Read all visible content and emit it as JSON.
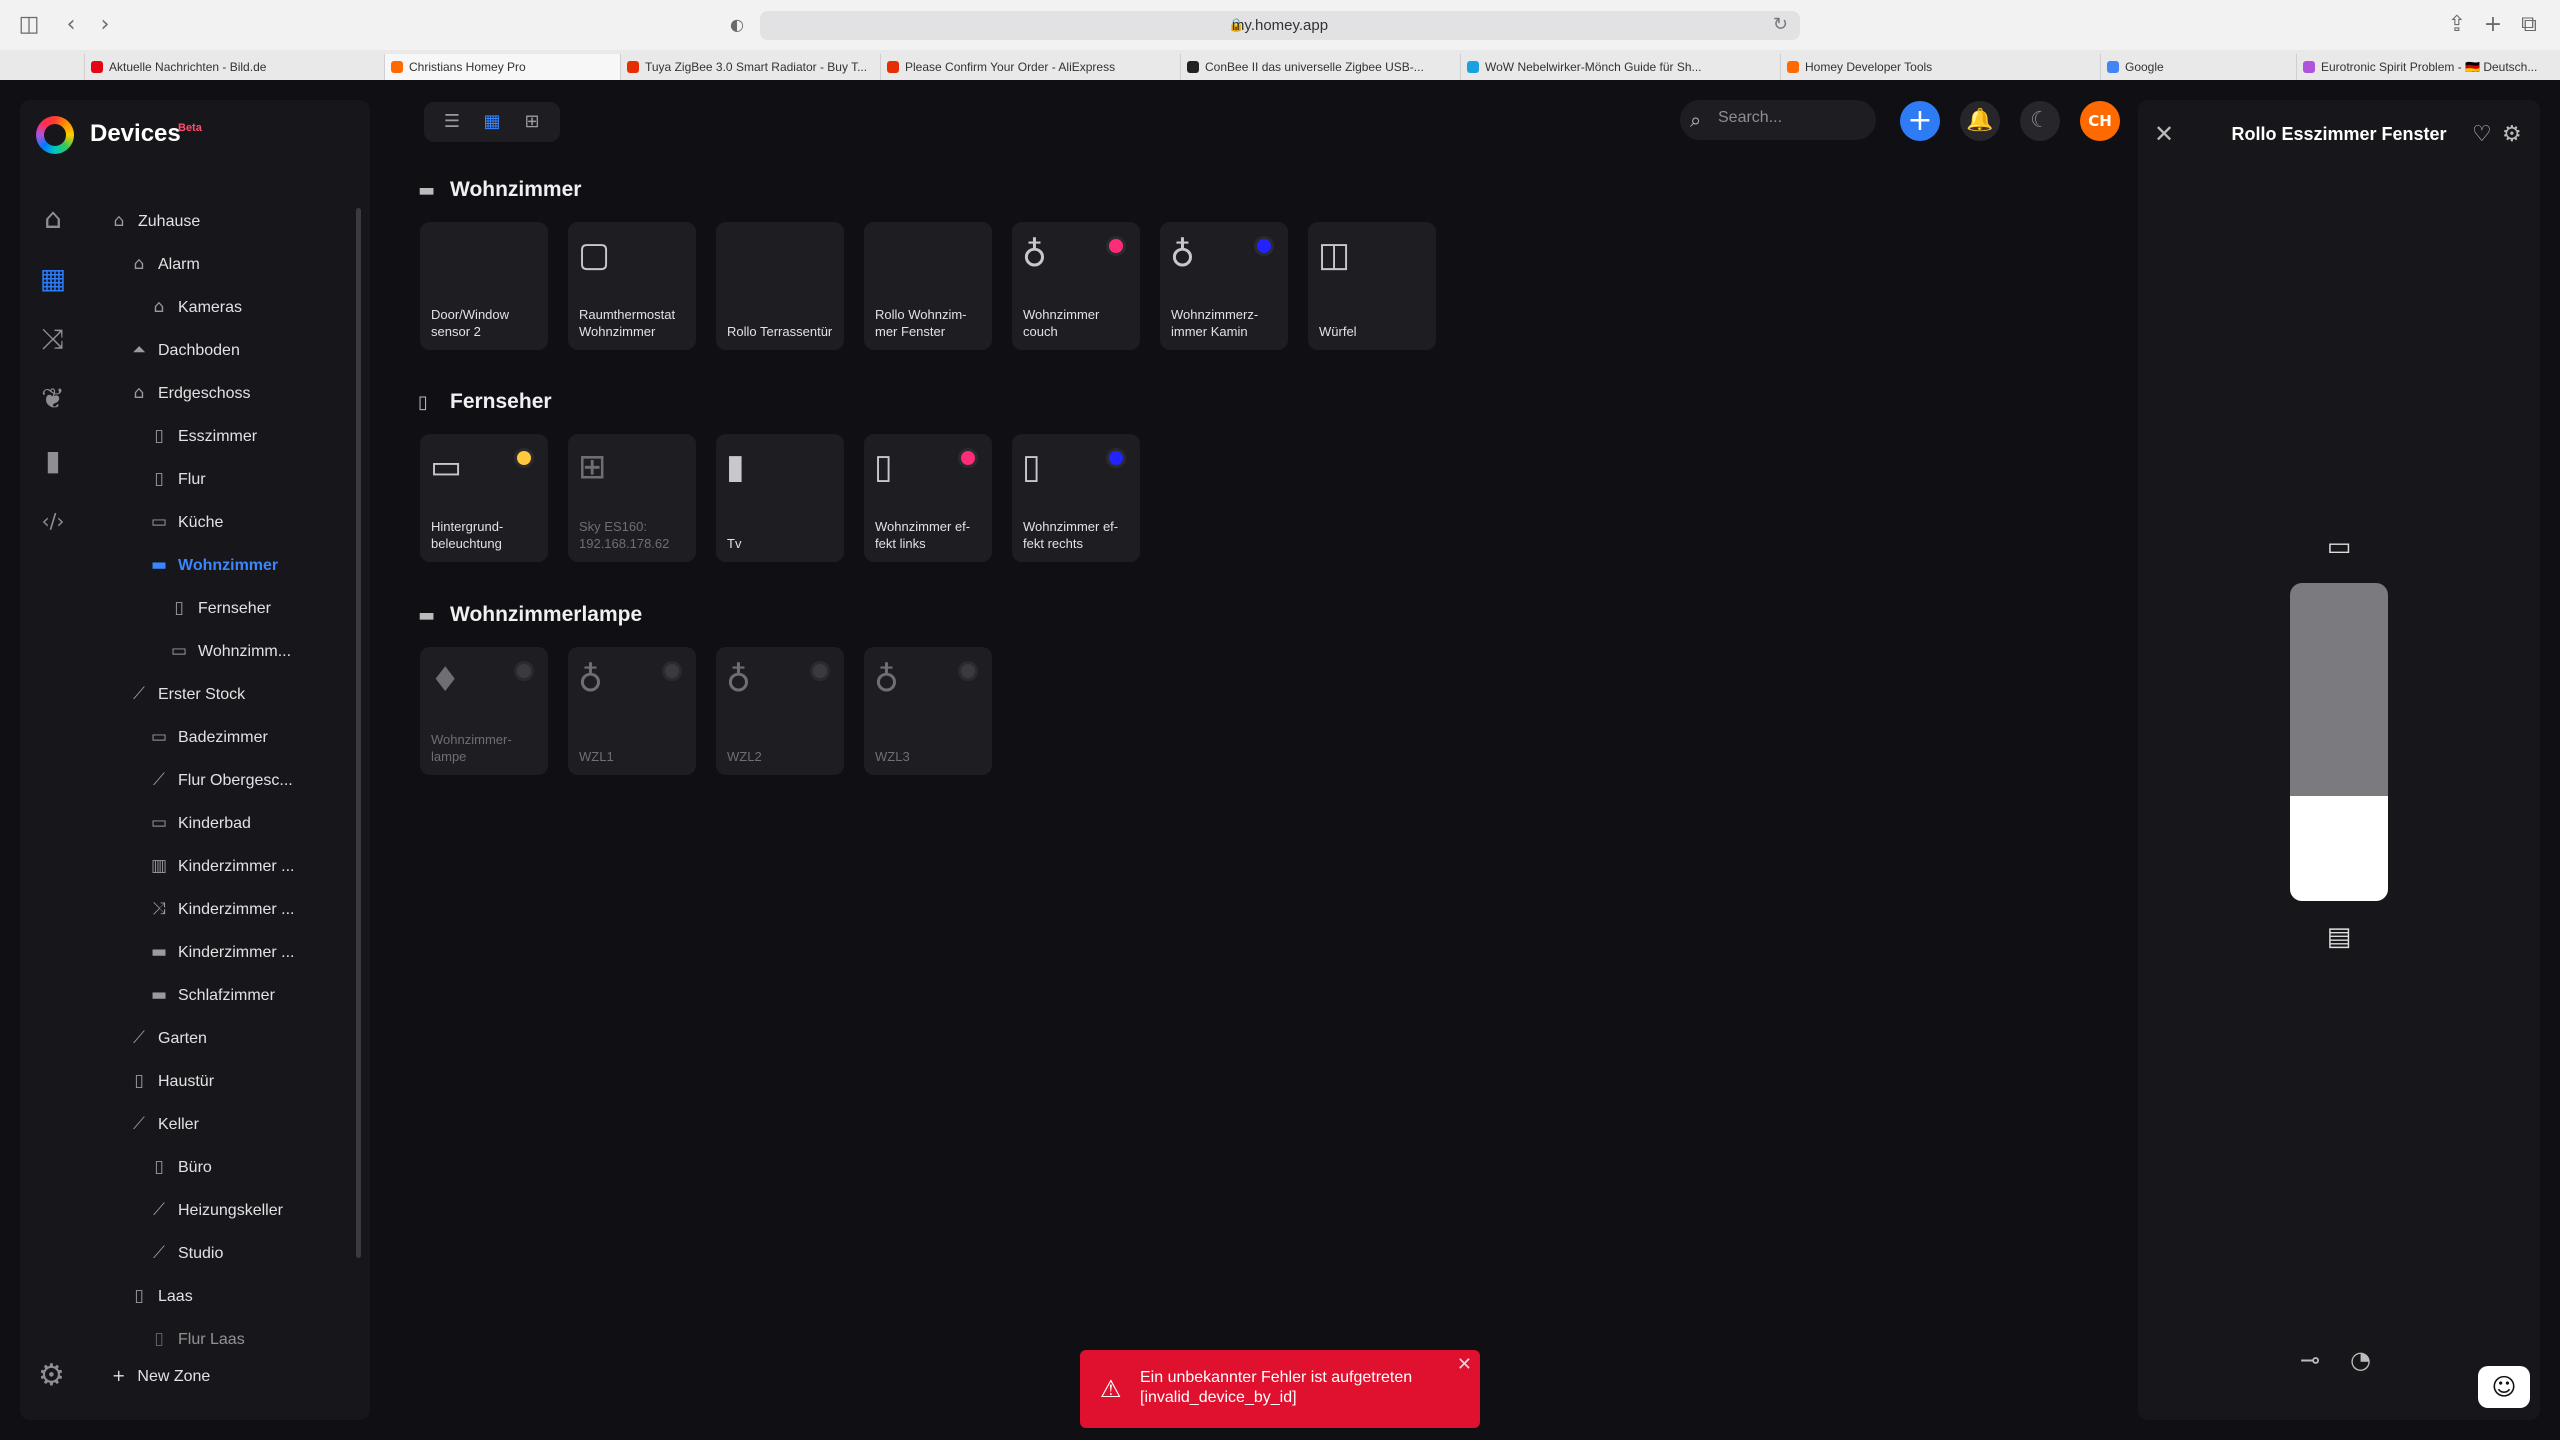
{
  "browser": {
    "url": "my.homey.app",
    "tabs": [
      {
        "label": "Aktuelle Nachrichten - Bild.de",
        "color": "#e30613"
      },
      {
        "label": "Christians Homey Pro",
        "color": "#ff6a00"
      },
      {
        "label": "Tuya ZigBee 3.0 Smart Radiator - Buy T...",
        "color": "#e62e04"
      },
      {
        "label": "Please Confirm Your Order - AliExpress",
        "color": "#e62e04"
      },
      {
        "label": "ConBee II das universelle Zigbee USB-...",
        "color": "#222222"
      },
      {
        "label": "WoW Nebelwirker-Mönch Guide für Sh...",
        "color": "#1ba1e2"
      },
      {
        "label": "Homey Developer Tools",
        "color": "#ff6a00"
      },
      {
        "label": "Google",
        "color": "#4285f4"
      },
      {
        "label": "Eurotronic Spirit Problem - 🇩🇪 Deutsch...",
        "color": "#af52de"
      }
    ]
  },
  "app": {
    "title": "Devices",
    "badge": "Beta"
  },
  "sidebar": {
    "rail": [
      {
        "name": "home-icon",
        "glyph": "⌂"
      },
      {
        "name": "devices-icon",
        "glyph": "▦"
      },
      {
        "name": "flows-icon",
        "glyph": "⤨"
      },
      {
        "name": "energy-icon",
        "glyph": "❦"
      },
      {
        "name": "insights-icon",
        "glyph": "▮"
      },
      {
        "name": "developer-icon",
        "glyph": "‹/›"
      }
    ],
    "zones": [
      {
        "label": "Zuhause",
        "level": 0,
        "icon": "⌂"
      },
      {
        "label": "Alarm",
        "level": 1,
        "icon": "⌂"
      },
      {
        "label": "Kameras",
        "level": 2,
        "icon": "⌂"
      },
      {
        "label": "Dachboden",
        "level": 1,
        "icon": "⏶"
      },
      {
        "label": "Erdgeschoss",
        "level": 1,
        "icon": "⌂"
      },
      {
        "label": "Esszimmer",
        "level": 2,
        "icon": "▯"
      },
      {
        "label": "Flur",
        "level": 2,
        "icon": "▯"
      },
      {
        "label": "Küche",
        "level": 2,
        "icon": "▭"
      },
      {
        "label": "Wohnzimmer",
        "level": 2,
        "icon": "▬",
        "active": true
      },
      {
        "label": "Fernseher",
        "level": 3,
        "icon": "▯"
      },
      {
        "label": "Wohnzimm...",
        "level": 3,
        "icon": "▭"
      },
      {
        "label": "Erster Stock",
        "level": 1,
        "icon": "⟋"
      },
      {
        "label": "Badezimmer",
        "level": 2,
        "icon": "▭"
      },
      {
        "label": "Flur Obergesc...",
        "level": 2,
        "icon": "⟋"
      },
      {
        "label": "Kinderbad",
        "level": 2,
        "icon": "▭"
      },
      {
        "label": "Kinderzimmer ...",
        "level": 2,
        "icon": "▥"
      },
      {
        "label": "Kinderzimmer ...",
        "level": 2,
        "icon": "⤨"
      },
      {
        "label": "Kinderzimmer ...",
        "level": 2,
        "icon": "▬"
      },
      {
        "label": "Schlafzimmer",
        "level": 2,
        "icon": "▬"
      },
      {
        "label": "Garten",
        "level": 1,
        "icon": "⟋"
      },
      {
        "label": "Haustür",
        "level": 1,
        "icon": "▯"
      },
      {
        "label": "Keller",
        "level": 1,
        "icon": "⟋"
      },
      {
        "label": "Büro",
        "level": 2,
        "icon": "▯"
      },
      {
        "label": "Heizungskeller",
        "level": 2,
        "icon": "⟋"
      },
      {
        "label": "Studio",
        "level": 2,
        "icon": "⟋"
      },
      {
        "label": "Laas",
        "level": 1,
        "icon": "▯"
      },
      {
        "label": "Flur Laas",
        "level": 2,
        "icon": "▯"
      }
    ],
    "new_zone": "New Zone"
  },
  "header": {
    "search_placeholder": "Search...",
    "avatar": "CH"
  },
  "sections": [
    {
      "title": "Wohnzimmer",
      "icon": "▬",
      "devices": [
        {
          "name": "Door/Window sensor 2",
          "icon": "",
          "dot": null,
          "off": false
        },
        {
          "name": "Raumthermostat Wohnzimmer",
          "icon": "▢",
          "dot": null,
          "off": false
        },
        {
          "name": "Rollo Terrassentür",
          "icon": "",
          "dot": null,
          "off": false
        },
        {
          "name": "Rollo Wohnzim-mer Fenster",
          "icon": "",
          "dot": null,
          "off": false
        },
        {
          "name": "Wohnzimmer couch",
          "icon": "♁",
          "dot": "#ff2d78",
          "off": false
        },
        {
          "name": "Wohnzimmerz-immer Kamin",
          "icon": "♁",
          "dot": "#2323ff",
          "off": false
        },
        {
          "name": "Würfel",
          "icon": "◫",
          "dot": null,
          "off": false
        }
      ]
    },
    {
      "title": "Fernseher",
      "icon": "▯",
      "devices": [
        {
          "name": "Hintergrund-beleuchtung",
          "icon": "▭",
          "dot": "#ffc83d",
          "off": false
        },
        {
          "name": "Sky ES160: 192.168.178.62",
          "icon": "⊞",
          "dot": null,
          "off": true
        },
        {
          "name": "Tv",
          "icon": "▮",
          "dot": null,
          "off": false
        },
        {
          "name": "Wohnzimmer ef-fekt links",
          "icon": "▯",
          "dot": "#ff2d78",
          "off": false
        },
        {
          "name": "Wohnzimmer ef-fekt rechts",
          "icon": "▯",
          "dot": "#2323ff",
          "off": false
        }
      ]
    },
    {
      "title": "Wohnzimmerlampe",
      "icon": "▬",
      "devices": [
        {
          "name": "Wohnzimmer-lampe",
          "icon": "♦",
          "dot": "#3a3a40",
          "off": true
        },
        {
          "name": "WZL1",
          "icon": "♁",
          "dot": "#3a3a40",
          "off": true
        },
        {
          "name": "WZL2",
          "icon": "♁",
          "dot": "#3a3a40",
          "off": true
        },
        {
          "name": "WZL3",
          "icon": "♁",
          "dot": "#3a3a40",
          "off": true
        }
      ]
    }
  ],
  "panel": {
    "title": "Rollo Esszimmer Fenster",
    "position_percent": 33
  },
  "toast": {
    "line1": "Ein unbekannter Fehler ist aufgetreten",
    "line2": "[invalid_device_by_id]"
  }
}
